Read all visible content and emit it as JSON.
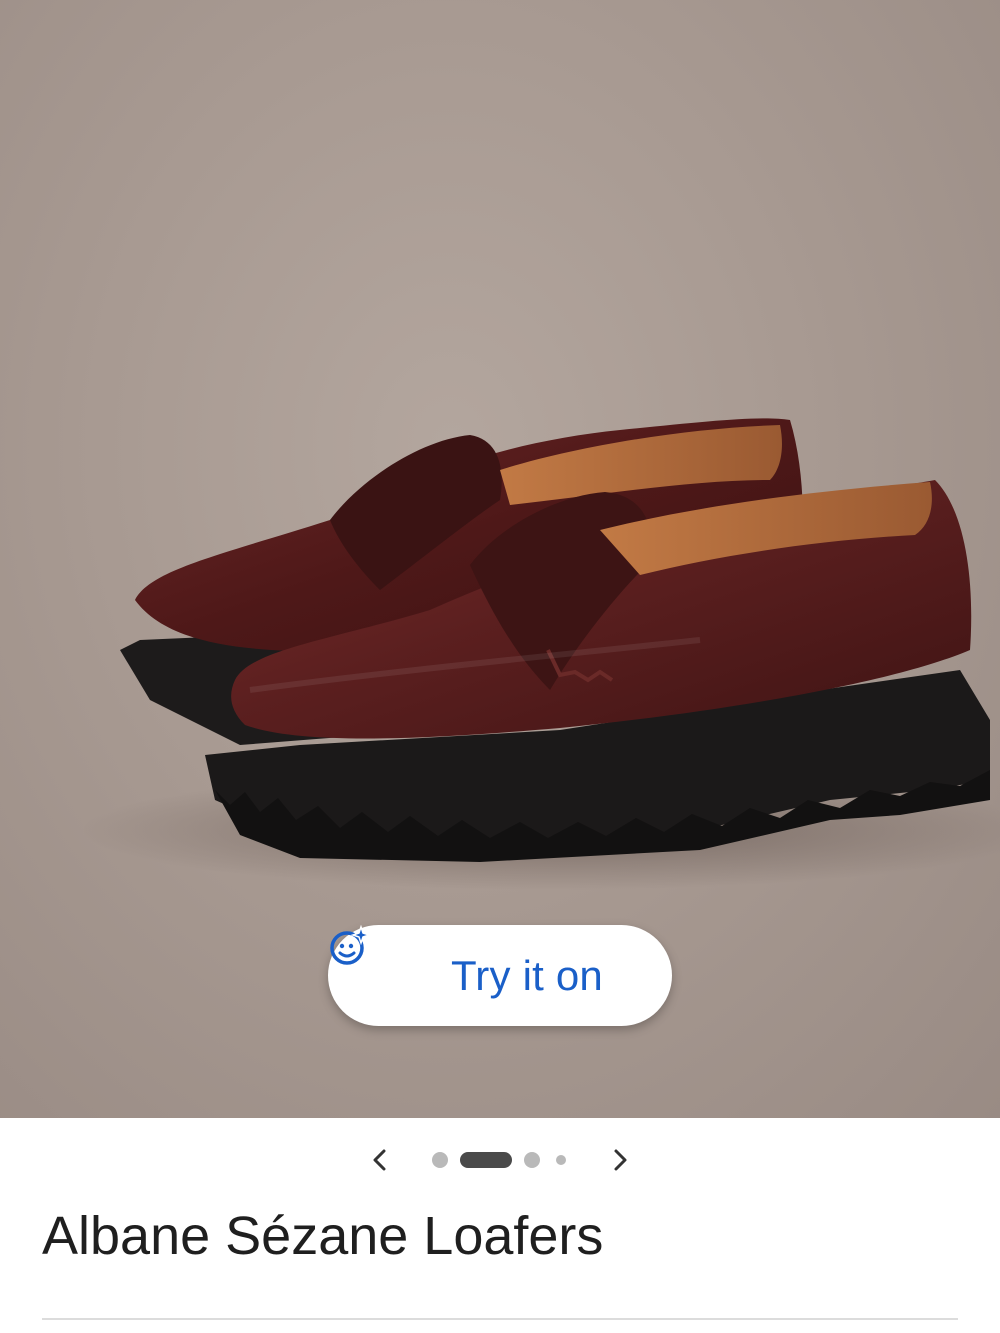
{
  "product": {
    "title": "Albane Sézane Loafers",
    "image_alt": "Burgundy leather penny loafers with black lug soles"
  },
  "try_on": {
    "label": "Try it on",
    "icon": "face-sparkle-icon",
    "color": "#1a5fc8"
  },
  "carousel": {
    "image_count": 4,
    "active_index": 1,
    "prev_icon": "chevron-left-icon",
    "next_icon": "chevron-right-icon"
  },
  "colors": {
    "leather": "#5a1f1f",
    "sole": "#1c1a1a",
    "lining": "#b76a3a",
    "background": "#a89a92"
  }
}
